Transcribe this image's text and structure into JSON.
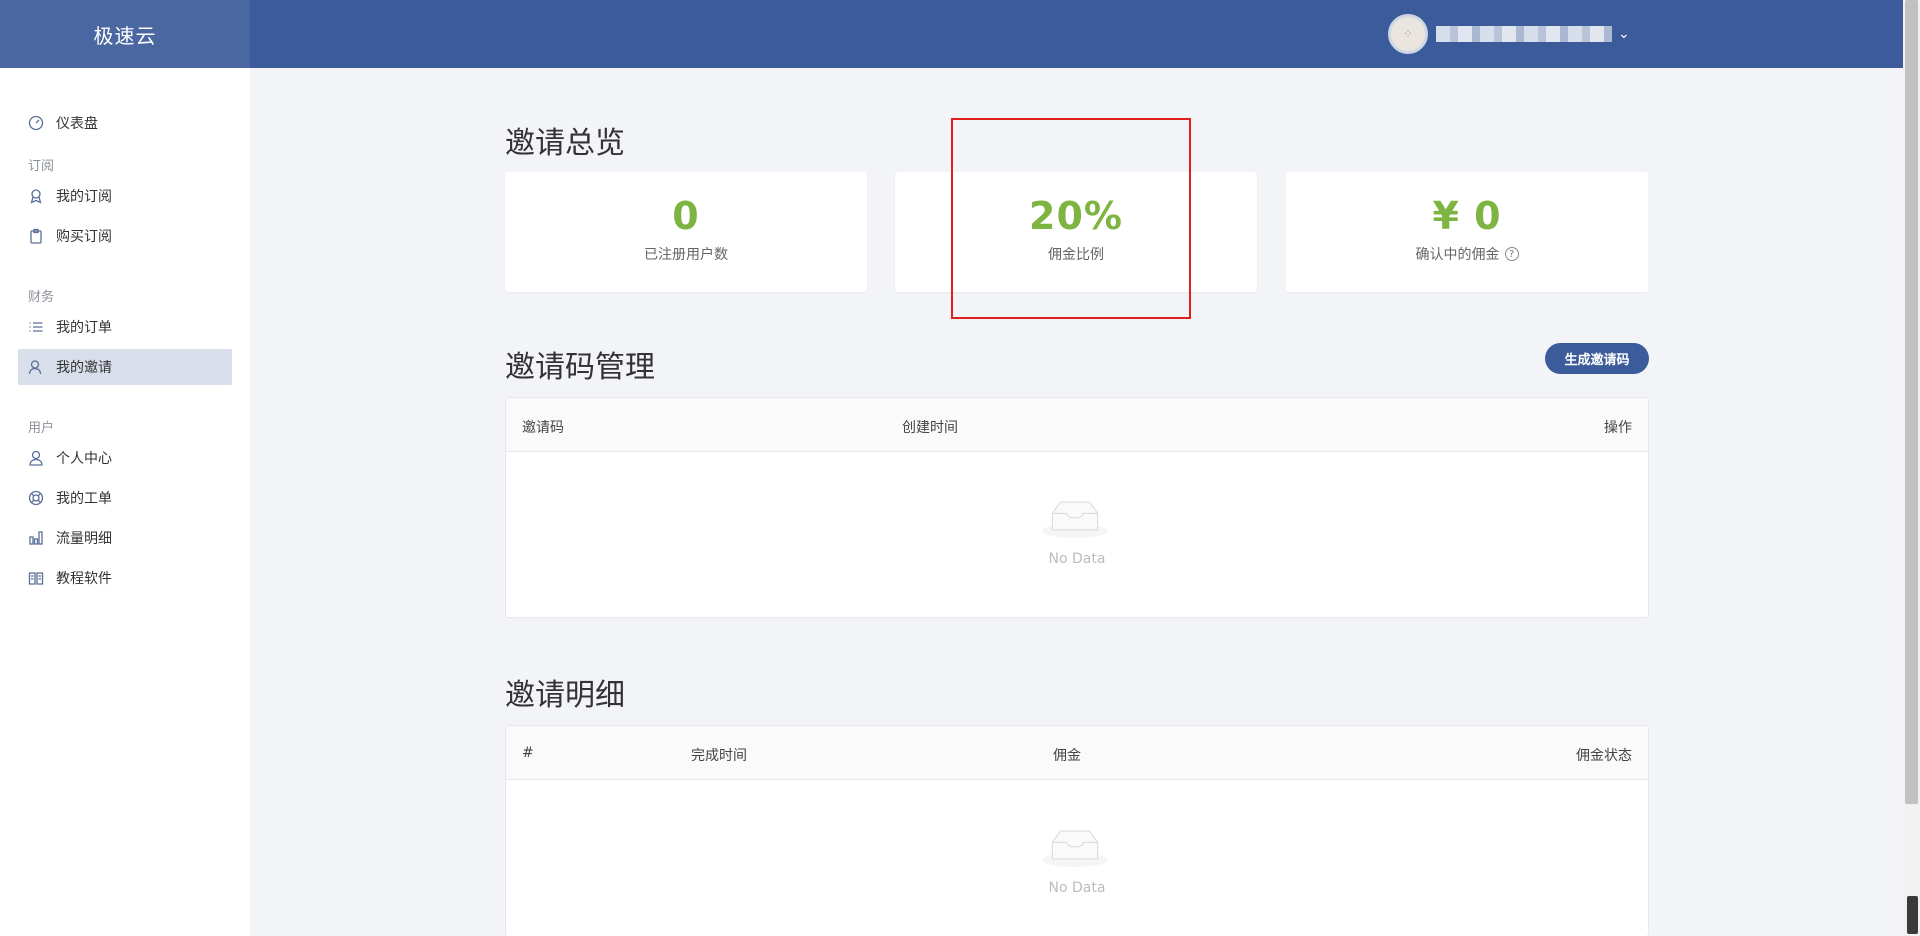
{
  "app": {
    "brand": "极速云"
  },
  "user": {
    "avatar_glyph": "⁘",
    "caret": "⌄"
  },
  "sidebar": {
    "items": [
      {
        "label": "仪表盘",
        "icon": "gauge-icon"
      },
      {
        "group": "订阅"
      },
      {
        "label": "我的订阅",
        "icon": "badge-icon"
      },
      {
        "label": "购买订阅",
        "icon": "clipboard-icon"
      },
      {
        "group": "财务"
      },
      {
        "label": "我的订单",
        "icon": "list-icon"
      },
      {
        "label": "我的邀请",
        "icon": "user-icon",
        "active": true
      },
      {
        "group": "用户"
      },
      {
        "label": "个人中心",
        "icon": "person-icon"
      },
      {
        "label": "我的工单",
        "icon": "lifebuoy-icon"
      },
      {
        "label": "流量明细",
        "icon": "bar-chart-icon"
      },
      {
        "label": "教程软件",
        "icon": "book-icon"
      }
    ]
  },
  "overview": {
    "title": "邀请总览",
    "cards": [
      {
        "value": "0",
        "label": "已注册用户数"
      },
      {
        "value": "20%",
        "label": "佣金比例"
      },
      {
        "value": "¥ 0",
        "label": "确认中的佣金",
        "help": "?"
      }
    ]
  },
  "codes": {
    "title": "邀请码管理",
    "generate_button": "生成邀请码",
    "columns": [
      "邀请码",
      "创建时间",
      "操作"
    ],
    "empty_text": "No Data"
  },
  "details": {
    "title": "邀请明细",
    "columns": [
      "#",
      "完成时间",
      "佣金",
      "佣金状态"
    ],
    "empty_text": "No Data"
  },
  "colors": {
    "topbar": "#3c5b9a",
    "accent_value": "#7eb542",
    "highlight": "#e0201c"
  }
}
